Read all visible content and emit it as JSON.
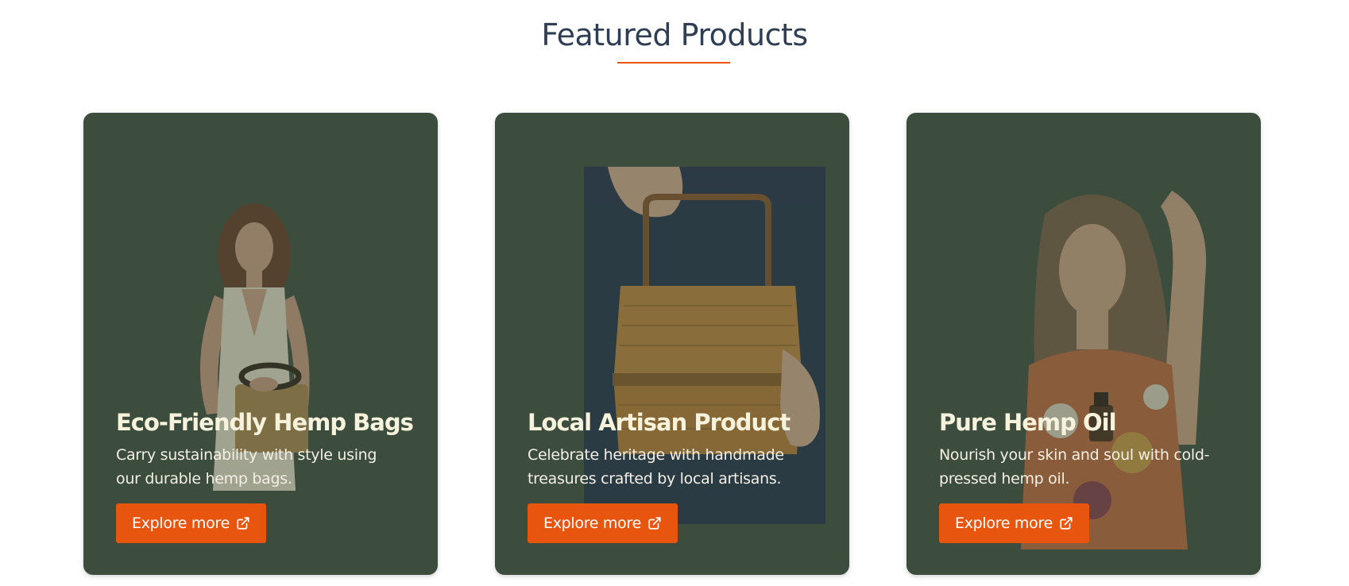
{
  "section": {
    "title": "Featured Products",
    "accent_color": "#e8550f",
    "card_bg_color": "#3c4d3e"
  },
  "cards": [
    {
      "title": "Eco-Friendly Hemp Bags",
      "description": "Carry sustainability with style using our durable hemp bags.",
      "button_label": "Explore more",
      "image_icon": "woman-with-hemp-bag-image"
    },
    {
      "title": "Local Artisan Product",
      "description": "Celebrate heritage with handmade treasures crafted by local artisans.",
      "button_label": "Explore more",
      "image_icon": "woven-basket-image"
    },
    {
      "title": "Pure Hemp Oil",
      "description": "Nourish your skin and soul with cold-pressed hemp oil.",
      "button_label": "Explore more",
      "image_icon": "woman-applying-hemp-oil-image"
    }
  ]
}
